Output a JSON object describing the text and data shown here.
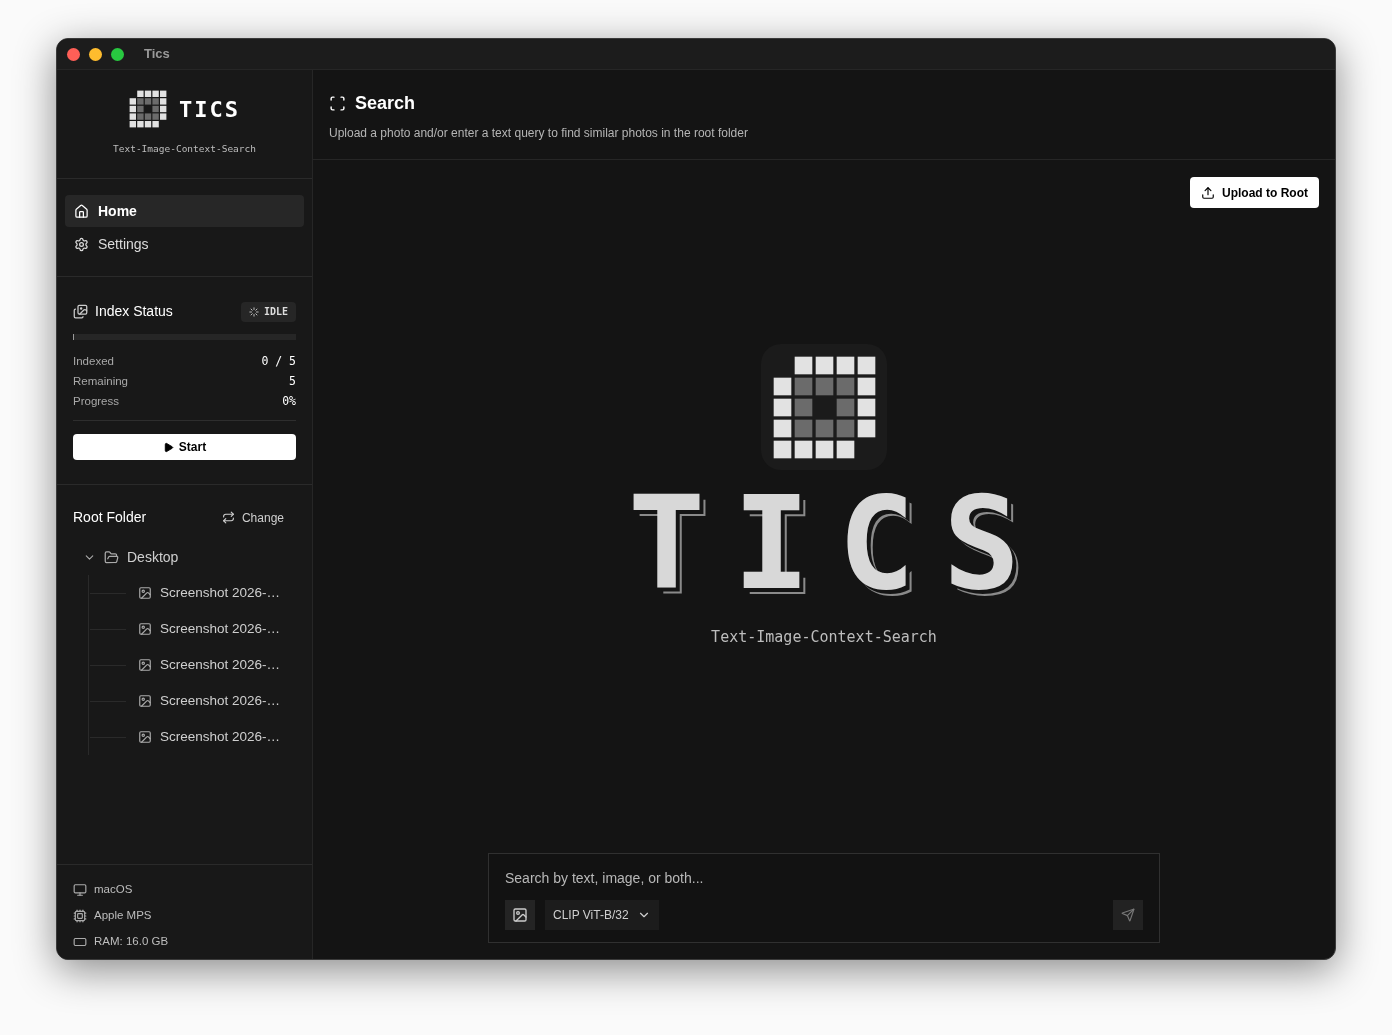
{
  "window": {
    "title": "Tics"
  },
  "sidebar": {
    "logo": {
      "name": "TICS",
      "subtitle": "Text-Image-Context-Search"
    },
    "nav": [
      {
        "label": "Home",
        "kind": "home",
        "selected": true
      },
      {
        "label": "Settings",
        "kind": "settings",
        "selected": false
      }
    ],
    "index_status": {
      "title": "Index Status",
      "badge": "IDLE",
      "level": 0,
      "stats": [
        {
          "label": "Indexed",
          "value": "0 / 5"
        },
        {
          "label": "Remaining",
          "value": "5"
        },
        {
          "label": "Progress",
          "value": "0%"
        }
      ],
      "start_button": "Start"
    },
    "root_folder": {
      "title": "Root Folder",
      "change_button": "Change",
      "tree": [
        {
          "label": "Desktop",
          "expanded": true,
          "children": [
            {
              "label": "Screenshot 2026-…"
            },
            {
              "label": "Screenshot 2026-…"
            },
            {
              "label": "Screenshot 2026-…"
            },
            {
              "label": "Screenshot 2026-…"
            },
            {
              "label": "Screenshot 2026-…"
            }
          ]
        }
      ]
    },
    "system": [
      {
        "kind": "os",
        "label": "macOS"
      },
      {
        "kind": "device",
        "label": "Apple MPS"
      },
      {
        "kind": "memory",
        "label": "RAM: 16.0 GB"
      }
    ]
  },
  "main": {
    "title": "Search",
    "subtitle": "Upload a photo and/or enter a text query to find similar photos in the root folder",
    "upload_button": "Upload to Root",
    "hero": {
      "name": "TICS",
      "subtitle": "Text-Image-Context-Search"
    },
    "search_box": {
      "placeholder": "Search by text, image, or both...",
      "model": "CLIP ViT-B/32"
    }
  }
}
